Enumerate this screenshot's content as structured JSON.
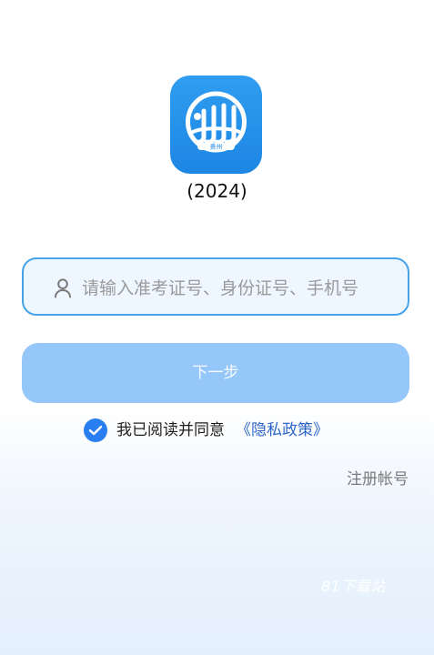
{
  "app": {
    "version": "(2024)",
    "logo": {
      "icon": "jjjjj-logo-icon",
      "caption": "贵州",
      "brand_color": "#1d86e4"
    }
  },
  "login": {
    "input": {
      "placeholder": "请输入准考证号、身份证号、手机号",
      "value": ""
    },
    "next_button_label": "下一步",
    "agreement": {
      "text": "我已阅读并同意",
      "link_label": "《隐私政策》",
      "checked": true
    },
    "register_label": "注册帐号"
  },
  "watermark": {
    "label": "81下载站"
  }
}
